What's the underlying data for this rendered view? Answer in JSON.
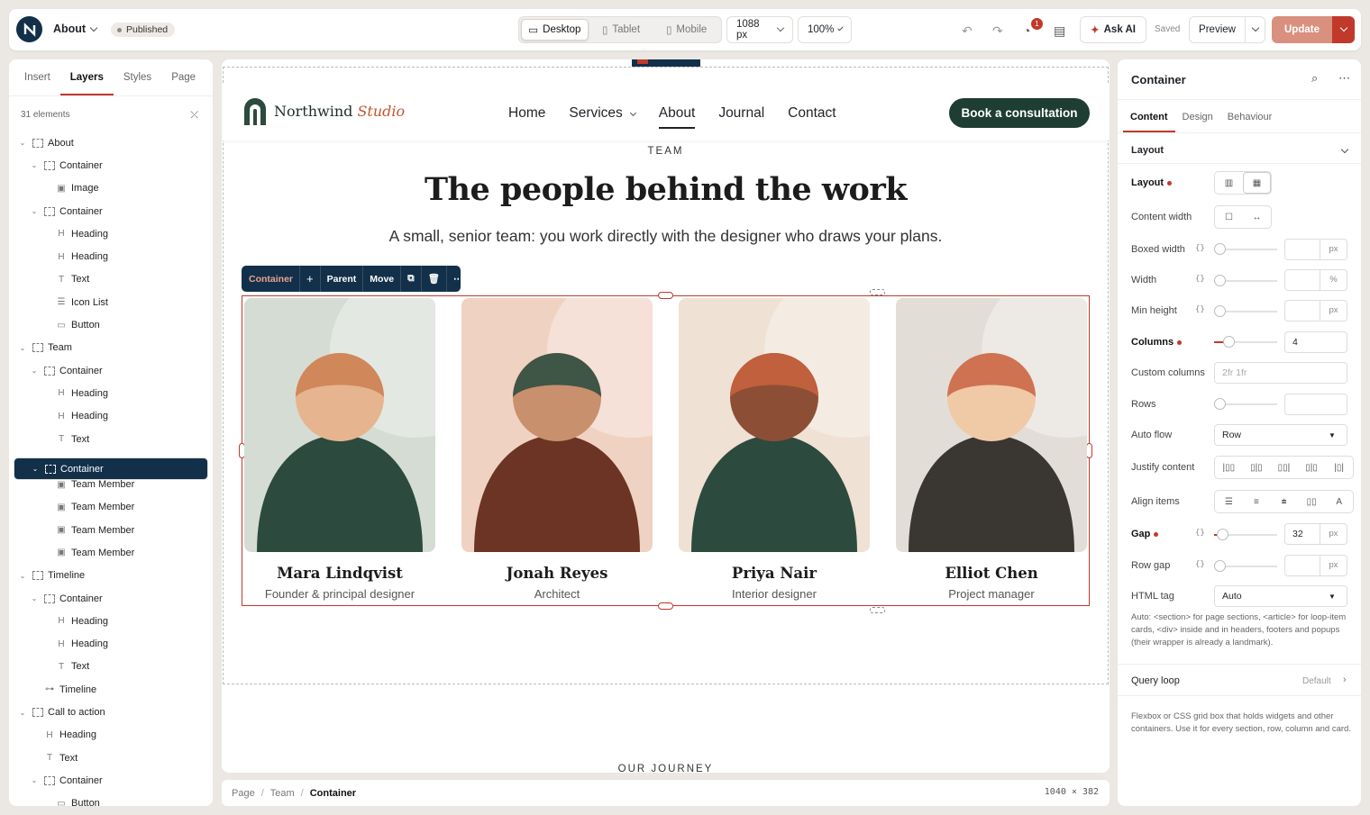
{
  "topbar": {
    "page_name": "About",
    "status": "Published",
    "devices": [
      "Desktop",
      "Tablet",
      "Mobile"
    ],
    "width": "1088 px",
    "zoom": "100%",
    "notifications": "1",
    "ask_ai": "Ask AI",
    "saved": "Saved",
    "preview": "Preview",
    "update": "Update"
  },
  "left": {
    "tabs": [
      "Insert",
      "Layers",
      "Styles",
      "Page"
    ],
    "count": "31 elements",
    "tree": [
      {
        "d": 0,
        "c": true,
        "i": "box",
        "t": "About"
      },
      {
        "d": 1,
        "c": true,
        "i": "box",
        "t": "Container"
      },
      {
        "d": 2,
        "c": false,
        "i": "img",
        "t": "Image"
      },
      {
        "d": 1,
        "c": true,
        "i": "box",
        "t": "Container"
      },
      {
        "d": 2,
        "c": false,
        "i": "H",
        "t": "Heading"
      },
      {
        "d": 2,
        "c": false,
        "i": "H",
        "t": "Heading"
      },
      {
        "d": 2,
        "c": false,
        "i": "T",
        "t": "Text"
      },
      {
        "d": 2,
        "c": false,
        "i": "list",
        "t": "Icon List"
      },
      {
        "d": 2,
        "c": false,
        "i": "btn",
        "t": "Button"
      },
      {
        "d": 0,
        "c": true,
        "i": "box",
        "t": "Team"
      },
      {
        "d": 1,
        "c": true,
        "i": "box",
        "t": "Container"
      },
      {
        "d": 2,
        "c": false,
        "i": "H",
        "t": "Heading"
      },
      {
        "d": 2,
        "c": false,
        "i": "H",
        "t": "Heading"
      },
      {
        "d": 2,
        "c": false,
        "i": "T",
        "t": "Text"
      },
      {
        "d": 1,
        "c": true,
        "i": "box",
        "t": "Container",
        "sel": true
      },
      {
        "d": 2,
        "c": false,
        "i": "member",
        "t": "Team Member"
      },
      {
        "d": 2,
        "c": false,
        "i": "member",
        "t": "Team Member"
      },
      {
        "d": 2,
        "c": false,
        "i": "member",
        "t": "Team Member"
      },
      {
        "d": 2,
        "c": false,
        "i": "member",
        "t": "Team Member"
      },
      {
        "d": 0,
        "c": true,
        "i": "box",
        "t": "Timeline"
      },
      {
        "d": 1,
        "c": true,
        "i": "box",
        "t": "Container"
      },
      {
        "d": 2,
        "c": false,
        "i": "H",
        "t": "Heading"
      },
      {
        "d": 2,
        "c": false,
        "i": "H",
        "t": "Heading"
      },
      {
        "d": 2,
        "c": false,
        "i": "T",
        "t": "Text"
      },
      {
        "d": 1,
        "c": false,
        "i": "tl",
        "t": "Timeline"
      },
      {
        "d": 0,
        "c": true,
        "i": "box",
        "t": "Call to action"
      },
      {
        "d": 1,
        "c": false,
        "i": "H",
        "t": "Heading"
      },
      {
        "d": 1,
        "c": false,
        "i": "T",
        "t": "Text"
      },
      {
        "d": 1,
        "c": true,
        "i": "box",
        "t": "Container"
      },
      {
        "d": 2,
        "c": false,
        "i": "btn",
        "t": "Button"
      }
    ]
  },
  "site": {
    "brand_main": "Northwind",
    "brand_accent": "Studio",
    "nav": [
      "Home",
      "Services",
      "About",
      "Journal",
      "Contact"
    ],
    "cta": "Book a consultation",
    "eyebrow": "TEAM",
    "heading": "The people behind the work",
    "lead": "A small, senior team: you work directly with the designer who draws your plans.",
    "next_eyebrow": "OUR JOURNEY",
    "members": [
      {
        "name": "Mara Lindqvist",
        "role": "Founder & principal designer",
        "bg": "#d5dcd3",
        "hair": "#d0875a",
        "skin": "#e6b48e",
        "body": "#2c4a3d"
      },
      {
        "name": "Jonah Reyes",
        "role": "Architect",
        "bg": "#f0d2c2",
        "hair": "#3f5546",
        "skin": "#c9906e",
        "body": "#6b3424"
      },
      {
        "name": "Priya Nair",
        "role": "Interior designer",
        "bg": "#efe1d4",
        "hair": "#c0603c",
        "skin": "#8c4f36",
        "body": "#2c4a3d"
      },
      {
        "name": "Elliot Chen",
        "role": "Project manager",
        "bg": "#e3ddd7",
        "hair": "#cf7252",
        "skin": "#f0c9a6",
        "body": "#3a3631"
      }
    ]
  },
  "float_toolbar": [
    "Container",
    "+",
    "Parent",
    "Move"
  ],
  "breadcrumb": {
    "items": [
      "Page",
      "Team"
    ],
    "current": "Container",
    "dims": "1040 × 382"
  },
  "right": {
    "title": "Container",
    "tabs": [
      "Content",
      "Design",
      "Behaviour"
    ],
    "section": "Layout",
    "labels": {
      "layout": "Layout",
      "content_width": "Content width",
      "boxed_width": "Boxed width",
      "width": "Width",
      "min_height": "Min height",
      "columns": "Columns",
      "custom_columns": "Custom columns",
      "rows": "Rows",
      "auto_flow": "Auto flow",
      "justify": "Justify content",
      "align": "Align items",
      "gap": "Gap",
      "row_gap": "Row gap",
      "html_tag": "HTML tag"
    },
    "units": {
      "boxed": "px",
      "width": "%",
      "min_height": "px",
      "gap": "px",
      "row_gap": "px"
    },
    "columns_value": "4",
    "columns_fraction": 0.23,
    "gap_value": "32",
    "gap_fraction": 0.13,
    "custom_columns_placeholder": "2fr 1fr",
    "auto_flow_value": "Row",
    "html_tag_value": "Auto",
    "html_hint": "Auto: <section> for page sections, <article> for loop-item cards, <div> inside and in headers, footers and popups (their wrapper is already a landmark).",
    "query_loop": "Query loop",
    "query_loop_value": "Default",
    "footer_hint": "Flexbox or CSS grid box that holds widgets and other containers. Use it for every section, row, column and card."
  }
}
